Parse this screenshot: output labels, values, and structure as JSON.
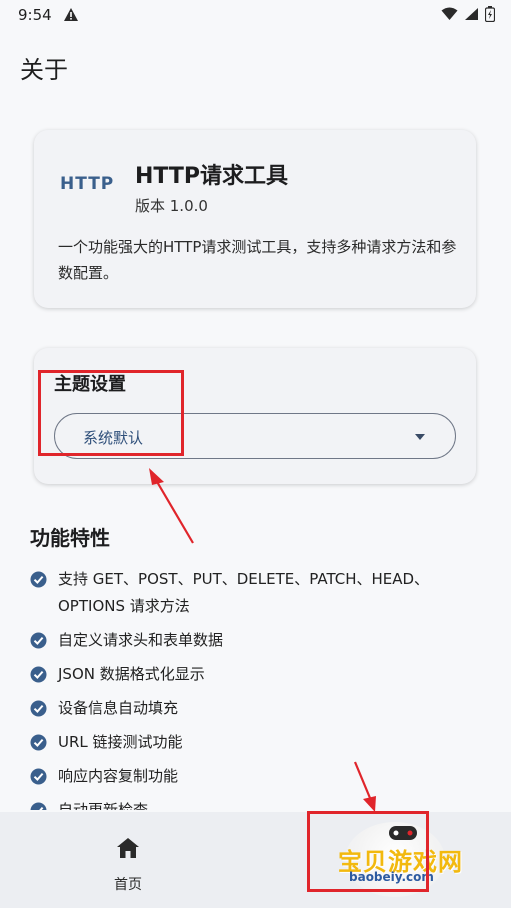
{
  "status_bar": {
    "time": "9:54"
  },
  "page": {
    "title": "关于"
  },
  "app_card": {
    "logo_text": "HTTP",
    "name": "HTTP请求工具",
    "version": "版本 1.0.0",
    "description": "一个功能强大的HTTP请求测试工具，支持多种请求方法和参数配置。"
  },
  "theme": {
    "title": "主题设置",
    "selected": "系统默认"
  },
  "features": {
    "title": "功能特性",
    "items": [
      "支持 GET、POST、PUT、DELETE、PATCH、HEAD、OPTIONS 请求方法",
      "自定义请求头和表单数据",
      "JSON 数据格式化显示",
      "设备信息自动填充",
      "URL 链接测试功能",
      "响应内容复制功能",
      "自动更新检查"
    ]
  },
  "bottom_nav": {
    "home_label": "首页"
  },
  "watermark": {
    "text": "宝贝游戏网",
    "url": "baobeiy.com"
  },
  "colors": {
    "accent": "#3a5f8c",
    "annotation": "#e0252b",
    "check": "#3a5f8c"
  },
  "icons": [
    "warning-icon",
    "wifi-icon",
    "signal-icon",
    "battery-icon",
    "check-icon",
    "home-icon",
    "dropdown-arrow-icon"
  ]
}
